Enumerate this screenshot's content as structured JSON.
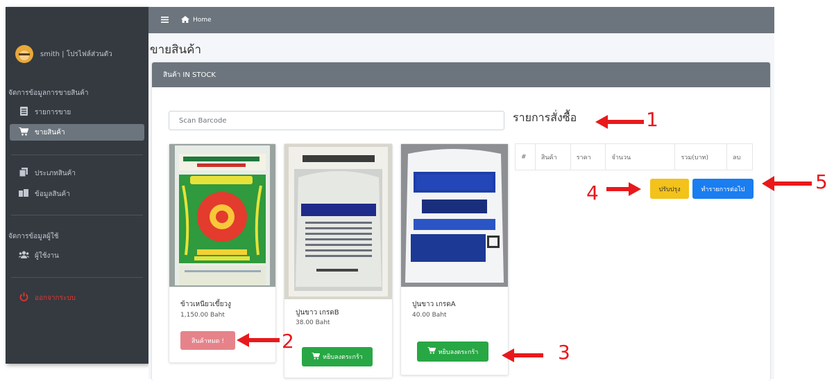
{
  "sidebar": {
    "user_label": "smith | โปรไฟล์ส่วนตัว",
    "section_sales": "จัดการข้อมูลการขายสินค้า",
    "item_sales_list": "รายการขาย",
    "item_sell": "ขายสินค้า",
    "item_category": "ประเภทสินค้า",
    "item_products": "ข้อมูลสินค้า",
    "section_users": "จัดการข้อมูลผู้ใช้",
    "item_users": "ผู้ใช้งาน",
    "item_logout": "ออกจากระบบ"
  },
  "topbar": {
    "home_label": "Home"
  },
  "page": {
    "title": "ขายสินค้า",
    "card_title": "สินค้า IN STOCK"
  },
  "search": {
    "placeholder": "Scan Barcode"
  },
  "products": [
    {
      "name": "ข้าวเหนียวเขี้ยวงู",
      "price": "1,150.00 Baht",
      "button": "สินค้าหมด !"
    },
    {
      "name": "ปูนขาว เกรดB",
      "price": "38.00 Baht",
      "button": "หยิบลงตระกร้า"
    },
    {
      "name": "ปูนขาว เกรดA",
      "price": "40.00 Baht",
      "button": "หยิบลงตระกร้า"
    }
  ],
  "order": {
    "title": "รายการสั่งซื้อ",
    "columns": [
      "#",
      "สินค้า",
      "ราคา",
      "จำนวน",
      "รวม(บาท)",
      "ลบ"
    ],
    "update_button": "ปรับปรุง",
    "next_button": "ทำรายการต่อไป"
  },
  "annotations": [
    "1",
    "2",
    "3",
    "4",
    "5"
  ],
  "colors": {
    "sidebar": "#343a40",
    "topbar": "#6c757d",
    "soldout": "#e6838a",
    "add": "#28a745",
    "update": "#f3c21b",
    "next": "#1a7df0",
    "annotation": "#e8191c"
  }
}
